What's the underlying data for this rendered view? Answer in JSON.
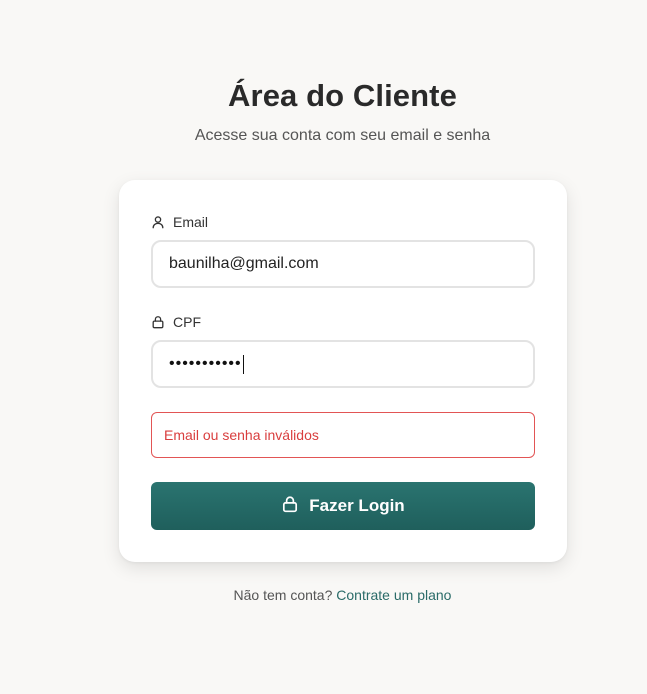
{
  "header": {
    "title": "Área do Cliente",
    "subtitle": "Acesse sua conta com seu email e senha"
  },
  "form": {
    "email_label": "Email",
    "email_icon": "user-icon",
    "email_value": "baunilha@gmail.com",
    "cpf_label": "CPF",
    "cpf_icon": "lock-icon",
    "cpf_masked_value": "•••••••••••",
    "error_message": "Email ou senha inválidos",
    "submit_label": "Fazer Login",
    "submit_icon": "lock-icon"
  },
  "footer": {
    "prompt": "Não tem conta?",
    "link_label": "Contrate um plano"
  },
  "colors": {
    "background": "#f9f8f6",
    "primary": "#22686a",
    "error": "#d93e3e",
    "link": "#2a6b68"
  }
}
